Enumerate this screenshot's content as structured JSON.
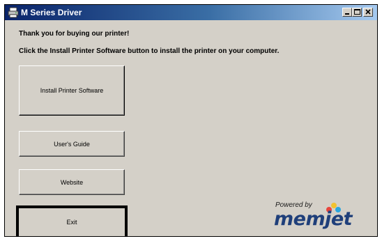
{
  "window": {
    "title": "M Series Driver",
    "controls": {
      "minimize": "minimize-icon",
      "maximize": "maximize-icon",
      "close": "close-icon"
    }
  },
  "content": {
    "greeting": "Thank you for buying our printer!",
    "instruction": "Click the Install Printer Software button to install the printer on your computer."
  },
  "buttons": {
    "install": "Install Printer Software",
    "guide": "User's Guide",
    "website": "Website",
    "exit": "Exit"
  },
  "logo": {
    "powered_by": "Powered by",
    "brand": "memjet",
    "colors": {
      "dot_red": "#e8453c",
      "dot_yellow": "#f2c230",
      "dot_blue": "#2aa6df",
      "wordmark": "#1f3f7a"
    }
  }
}
